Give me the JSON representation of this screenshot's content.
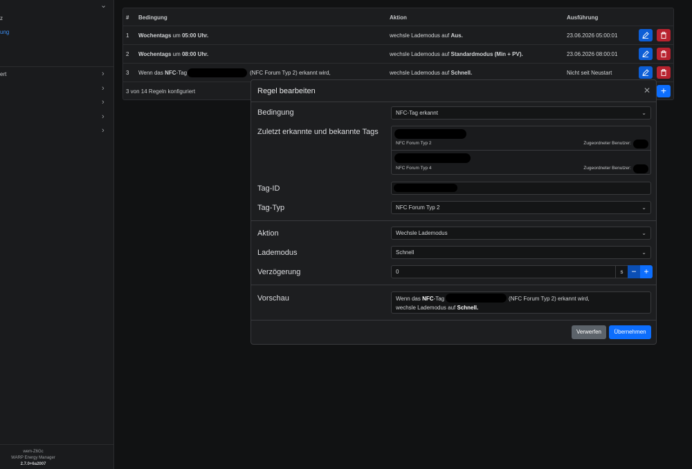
{
  "sidebar": {
    "frag1": "z",
    "frag2": "ung",
    "frag3": "ert",
    "footer": {
      "hostname": "wem-Z6Gc",
      "product": "WARP Energy Manager",
      "version": "2.7.0+6a2007"
    }
  },
  "rules_table": {
    "headers": {
      "num": "#",
      "condition": "Bedingung",
      "action": "Aktion",
      "execution": "Ausführung"
    },
    "rows": [
      {
        "num": "1",
        "cond_bold": "Wochentags",
        "cond_rest": " um ",
        "cond_time": "05:00 Uhr.",
        "action_pre": "wechsle Lademodus auf ",
        "action_bold": "Aus.",
        "execution": "23.06.2026 05:00:01"
      },
      {
        "num": "2",
        "cond_bold": "Wochentags",
        "cond_rest": " um ",
        "cond_time": "08:00 Uhr.",
        "action_pre": "wechsle Lademodus auf ",
        "action_bold": "Standardmodus (Min + PV).",
        "execution": "23.06.2026 08:00:01"
      },
      {
        "num": "3",
        "cond_pre": "Wenn das ",
        "cond_bold": "NFC",
        "cond_mid": "-Tag",
        "cond_post": "(NFC Forum Typ 2) erkannt wird,",
        "action_pre": "wechsle Lademodus auf ",
        "action_bold": "Schnell.",
        "execution": "Nicht seit Neustart"
      }
    ],
    "footer": "3 von 14 Regeln konfiguriert"
  },
  "modal": {
    "title": "Regel bearbeiten",
    "condition_label": "Bedingung",
    "condition_value": "NFC-Tag erkannt",
    "tags_label": "Zuletzt erkannte und bekannte Tags",
    "tags": [
      {
        "type": "NFC Forum Typ 2",
        "user_label": "Zugeordneter Benutzer:"
      },
      {
        "type": "NFC Forum Typ 4",
        "user_label": "Zugeordneter Benutzer:"
      }
    ],
    "tag_id_label": "Tag-ID",
    "tag_type_label": "Tag-Typ",
    "tag_type_value": "NFC Forum Typ 2",
    "action_label": "Aktion",
    "action_value": "Wechsle Lademodus",
    "charge_mode_label": "Lademodus",
    "charge_mode_value": "Schnell",
    "delay_label": "Verzögerung",
    "delay_value": "0",
    "delay_unit": "s",
    "preview_label": "Vorschau",
    "preview": {
      "l1_pre": "Wenn das ",
      "l1_bold": "NFC",
      "l1_mid": "-Tag",
      "l1_post": "(NFC Forum Typ 2) erkannt wird,",
      "l2_pre": "wechsle Lademodus auf ",
      "l2_bold": "Schnell."
    },
    "discard_label": "Verwerfen",
    "apply_label": "Übernehmen"
  },
  "colors": {
    "primary": "#0d6efd",
    "danger": "#b8232f",
    "secondary": "#5c636a"
  }
}
